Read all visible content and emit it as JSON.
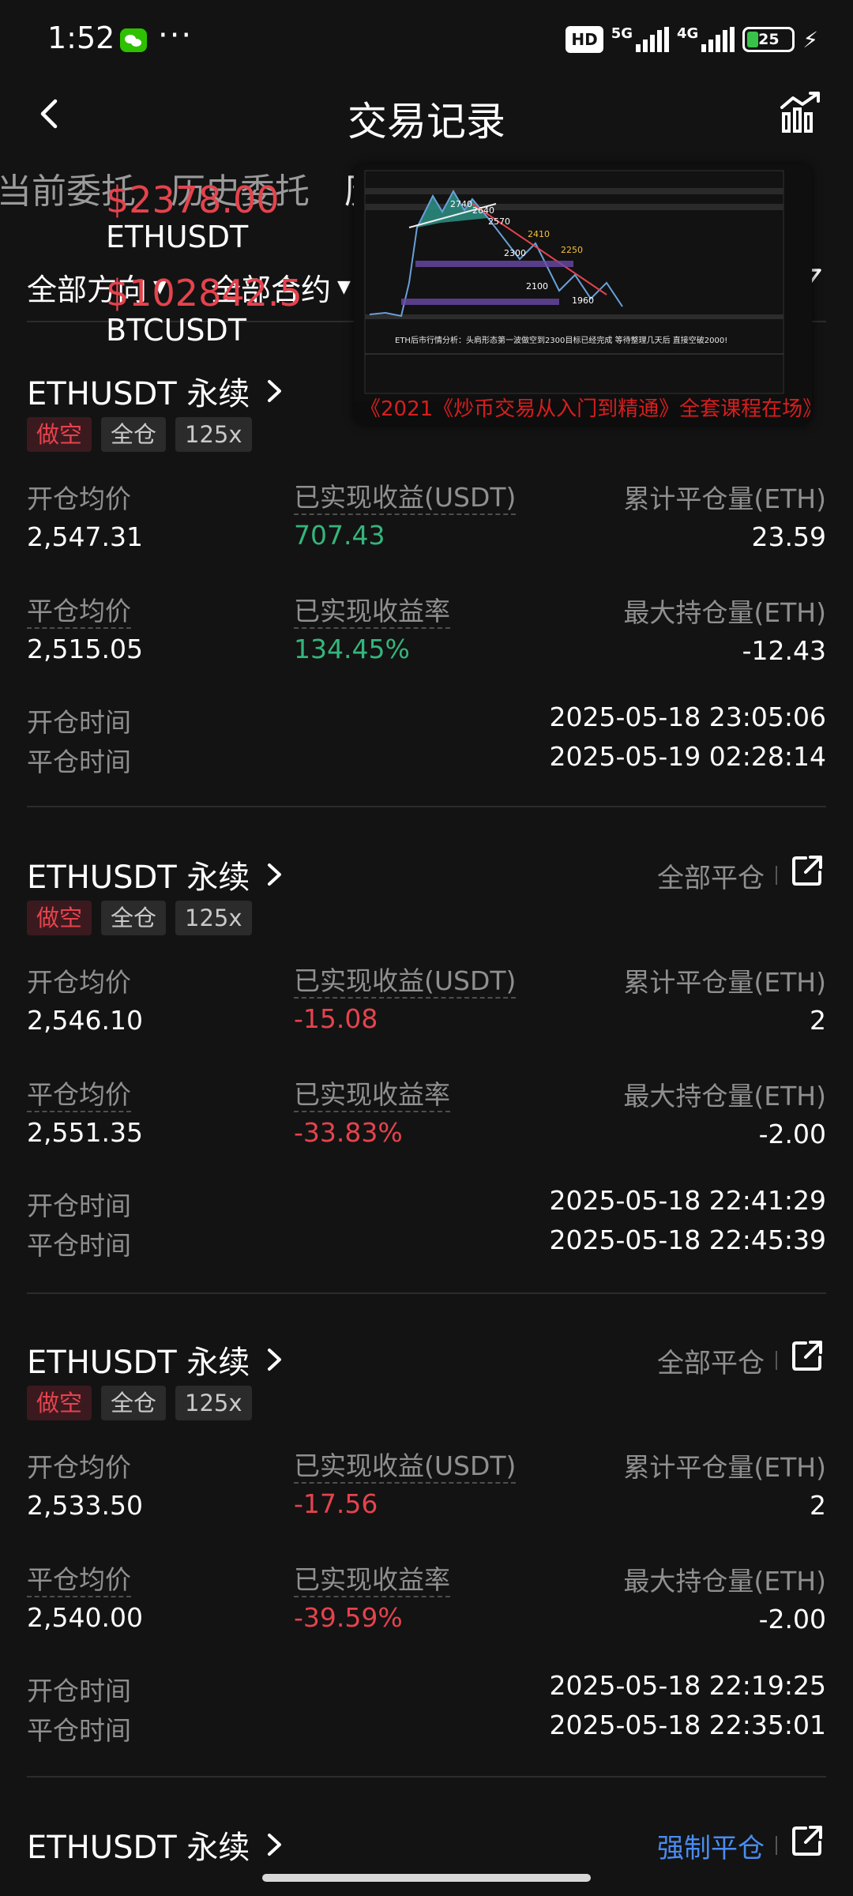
{
  "status_bar": {
    "time": "1:52",
    "more": "···",
    "hd": "HD",
    "net1": "5G",
    "net2": "4G",
    "battery": "25"
  },
  "nav": {
    "title": "交易记录"
  },
  "tabs": [
    "当前委托",
    "历史委托",
    "历"
  ],
  "filters": {
    "direction": "全部方向",
    "contract": "全部合约"
  },
  "overlay": {
    "eth_price": "$2378.00",
    "eth_symbol": "ETHUSDT",
    "btc_price": "$102842.5",
    "btc_symbol": "BTCUSDT"
  },
  "video": {
    "caption": "《2021《炒币交易从入门到精通》全套课程在场》",
    "chart_text": "ETH后市行情分析：头肩形态第一波做空到2300目标已经完成 等待整理几天后 直接空破2000!",
    "levels": [
      "2740",
      "2640",
      "2570",
      "2410",
      "2300",
      "2250",
      "2100",
      "1960"
    ]
  },
  "labels": {
    "open_avg": "开仓均价",
    "close_avg": "平仓均价",
    "realized_pnl": "已实现收益(USDT)",
    "realized_rate": "已实现收益率",
    "total_closed": "累计平仓量(ETH)",
    "max_position": "最大持仓量(ETH)",
    "open_time": "开仓时间",
    "close_time": "平仓时间"
  },
  "colors": {
    "positive": "#35b57c",
    "negative": "#e5434d",
    "forced_close": "#4a8cf0"
  },
  "trades": [
    {
      "symbol": "ETHUSDT 永续",
      "close_status": "",
      "tags": [
        "做空",
        "全仓",
        "125x"
      ],
      "open_avg": "2,547.31",
      "close_avg": "2,515.05",
      "realized_pnl": "707.43",
      "realized_rate": "134.45%",
      "total_closed": "23.59",
      "max_position": "-12.43",
      "open_time": "2025-05-18 23:05:06",
      "close_time": "2025-05-19 02:28:14"
    },
    {
      "symbol": "ETHUSDT 永续",
      "close_status": "全部平仓",
      "tags": [
        "做空",
        "全仓",
        "125x"
      ],
      "open_avg": "2,546.10",
      "close_avg": "2,551.35",
      "realized_pnl": "-15.08",
      "realized_rate": "-33.83%",
      "total_closed": "2",
      "max_position": "-2.00",
      "open_time": "2025-05-18 22:41:29",
      "close_time": "2025-05-18 22:45:39"
    },
    {
      "symbol": "ETHUSDT 永续",
      "close_status": "全部平仓",
      "tags": [
        "做空",
        "全仓",
        "125x"
      ],
      "open_avg": "2,533.50",
      "close_avg": "2,540.00",
      "realized_pnl": "-17.56",
      "realized_rate": "-39.59%",
      "total_closed": "2",
      "max_position": "-2.00",
      "open_time": "2025-05-18 22:19:25",
      "close_time": "2025-05-18 22:35:01"
    },
    {
      "symbol": "ETHUSDT 永续",
      "close_status": "强制平仓"
    }
  ]
}
